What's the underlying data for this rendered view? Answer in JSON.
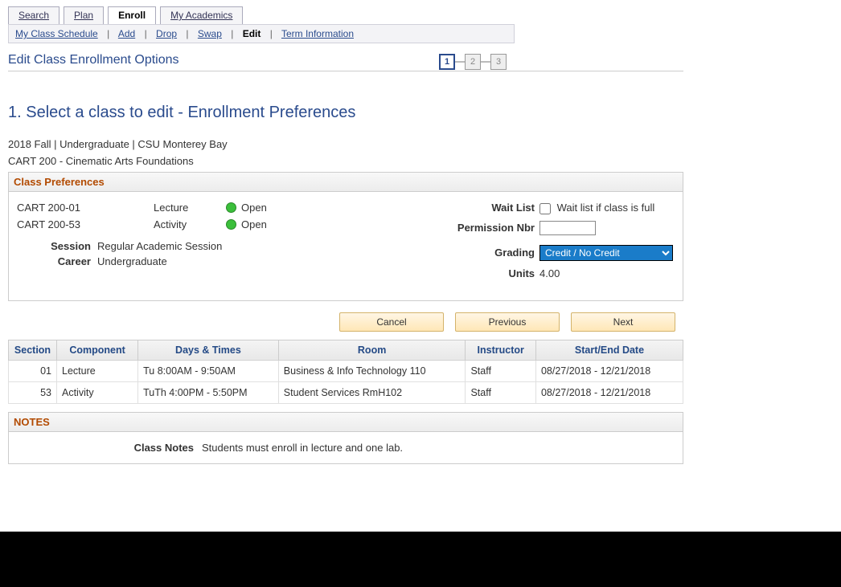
{
  "tabs": {
    "search": "Search",
    "plan": "Plan",
    "enroll": "Enroll",
    "academics": "My Academics"
  },
  "subnav": {
    "schedule": "My Class Schedule",
    "add": "Add",
    "drop": "Drop",
    "swap": "Swap",
    "edit": "Edit",
    "term": "Term Information"
  },
  "page_title": "Edit Class Enrollment Options",
  "steps": {
    "s1": "1",
    "s2": "2",
    "s3": "3"
  },
  "section_heading": "1.  Select a class to edit - Enrollment Preferences",
  "context": "2018 Fall | Undergraduate | CSU Monterey Bay",
  "course": "CART  200 - Cinematic Arts Foundations",
  "prefs": {
    "header": "Class Preferences",
    "rows": [
      {
        "code": "CART  200-01",
        "component": "Lecture",
        "status": "Open"
      },
      {
        "code": "CART  200-53",
        "component": "Activity",
        "status": "Open"
      }
    ],
    "session_label": "Session",
    "session_value": "Regular Academic Session",
    "career_label": "Career",
    "career_value": "Undergraduate",
    "waitlist_label": "Wait List",
    "waitlist_text": "Wait list if class is full",
    "perm_label": "Permission Nbr",
    "perm_value": "",
    "grading_label": "Grading",
    "grading_value": "Credit / No Credit",
    "units_label": "Units",
    "units_value": "4.00"
  },
  "buttons": {
    "cancel": "Cancel",
    "previous": "Previous",
    "next": "Next"
  },
  "table": {
    "headers": {
      "section": "Section",
      "component": "Component",
      "days": "Days & Times",
      "room": "Room",
      "instructor": "Instructor",
      "dates": "Start/End Date"
    },
    "rows": [
      {
        "section": "01",
        "component": "Lecture",
        "days": "Tu 8:00AM - 9:50AM",
        "room": "Business & Info Technology 110",
        "instructor": "Staff",
        "dates": "08/27/2018 - 12/21/2018"
      },
      {
        "section": "53",
        "component": "Activity",
        "days": "TuTh 4:00PM - 5:50PM",
        "room": "Student Services RmH102",
        "instructor": "Staff",
        "dates": "08/27/2018 - 12/21/2018"
      }
    ]
  },
  "notes": {
    "header": "NOTES",
    "label": "Class Notes",
    "text": "Students must enroll in lecture and one lab."
  }
}
